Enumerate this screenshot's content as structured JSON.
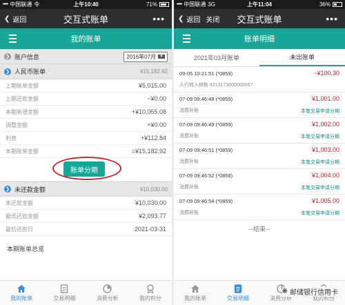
{
  "left": {
    "status": {
      "signal": "•••••",
      "carrier": "中国联通",
      "network": "令",
      "time": "上午10:40",
      "battery": "71%"
    },
    "nav": {
      "back": "返回",
      "title": "交互式账单",
      "more": "•••"
    },
    "title_bar": "我的账单",
    "account_info": {
      "label": "账户信息",
      "month": "2016年07月"
    },
    "rmb": {
      "label": "人民币账单",
      "value": "¥15,182.92"
    },
    "rows": [
      {
        "label": "上期账单金额",
        "value": "¥5,015.00"
      },
      {
        "label": "上期还款金额",
        "value": "−¥0.00"
      },
      {
        "label": "本期新增金额",
        "value": "+¥10,055.08"
      },
      {
        "label": "调整金额",
        "value": "+¥0.00"
      },
      {
        "label": "利息",
        "value": "+¥112.84"
      },
      {
        "label": "本期账单金额",
        "value": "=¥15,182.92"
      }
    ],
    "installment_button": "账单分期",
    "unpaid": {
      "label": "未还款金额",
      "value": "¥10,030.00"
    },
    "rows2": [
      {
        "label": "未还款金额",
        "value": "¥10,030.00"
      },
      {
        "label": "最低还款金额",
        "value": "¥2,093.77"
      },
      {
        "label": "最后还款日",
        "value": "2021-03-31"
      }
    ],
    "total_label": "本期账单总览",
    "tabs": [
      {
        "label": "我的账单",
        "icon": "home-icon"
      },
      {
        "label": "交易明细",
        "icon": "document-icon"
      },
      {
        "label": "消费分析",
        "icon": "pie-chart-icon"
      },
      {
        "label": "我的积分",
        "icon": "medal-icon"
      }
    ]
  },
  "right": {
    "status": {
      "signal": "•••••",
      "carrier": "中国联通",
      "network": "3G",
      "time": "上午11:04",
      "battery": "36%"
    },
    "nav": {
      "back": "返回",
      "close": "关闭",
      "title": "交互式账单",
      "more": "•••"
    },
    "title_bar": "账单明细",
    "tabs_top": [
      "2021年03月账单",
      "未出账单"
    ],
    "transactions": [
      {
        "line1": "09-05 10:21:51 (*0859)",
        "line2": "人行转入转帐 4213173000000067",
        "amount": "−¥100.30",
        "link": ""
      },
      {
        "line1": "07-09 09:46:48 (*0859)",
        "line2": "消费补账",
        "amount": "¥1,001.00",
        "link": "本笔交易申请分期"
      },
      {
        "line1": "07-09 09:46:49 (*0859)",
        "line2": "消费补账",
        "amount": "¥1,002.00",
        "link": "本笔交易申请分期"
      },
      {
        "line1": "07-09 09:46:51 (*0859)",
        "line2": "消费补账",
        "amount": "¥1,003.00",
        "link": "本笔交易申请分期"
      },
      {
        "line1": "07-09 09:46:52 (*0859)",
        "line2": "消费补账",
        "amount": "¥1,004.00",
        "link": "本笔交易申请分期"
      },
      {
        "line1": "07-09 09:46:54 (*0859)",
        "line2": "消费补账",
        "amount": "¥1,005.00",
        "link": "本笔交易申请分期"
      }
    ],
    "end_text": "--结束--",
    "tabs": [
      {
        "label": "我的账单",
        "icon": "home-icon"
      },
      {
        "label": "交易明细",
        "icon": "document-icon"
      },
      {
        "label": "消费分析",
        "icon": "pie-chart-icon"
      },
      {
        "label": "我的积分",
        "icon": "medal-icon"
      }
    ],
    "watermark": "邮储银行信用卡"
  },
  "colors": {
    "teal": "#16a596",
    "dark": "#2e2e2e",
    "red": "#c81e1e",
    "blue": "#3a8fd8"
  }
}
